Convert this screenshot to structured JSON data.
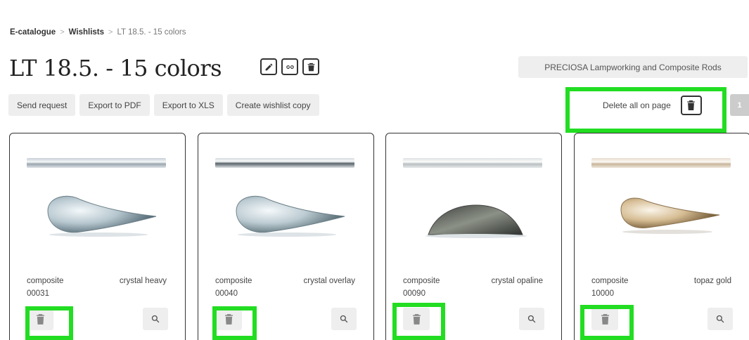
{
  "breadcrumb": {
    "items": [
      "E-catalogue",
      "Wishlists"
    ],
    "current": "LT 18.5. - 15 colors",
    "separator": ">"
  },
  "header": {
    "title": "LT 18.5. - 15 colors",
    "category_label": "PRECIOSA Lampworking and Composite Rods"
  },
  "toolbar": {
    "send_request": "Send request",
    "export_pdf": "Export to PDF",
    "export_xls": "Export to XLS",
    "create_copy": "Create wishlist copy",
    "delete_all": "Delete all on page",
    "page_number": "1"
  },
  "products": [
    {
      "type": "composite",
      "color": "crystal heavy",
      "code": "00031"
    },
    {
      "type": "composite",
      "color": "crystal overlay",
      "code": "00040"
    },
    {
      "type": "composite",
      "color": "crystal opaline",
      "code": "00090"
    },
    {
      "type": "composite",
      "color": "topaz gold",
      "code": "10000"
    }
  ],
  "colors": {
    "highlight": "#22dd22",
    "button_bg": "#eeeeee",
    "text": "#333333"
  }
}
